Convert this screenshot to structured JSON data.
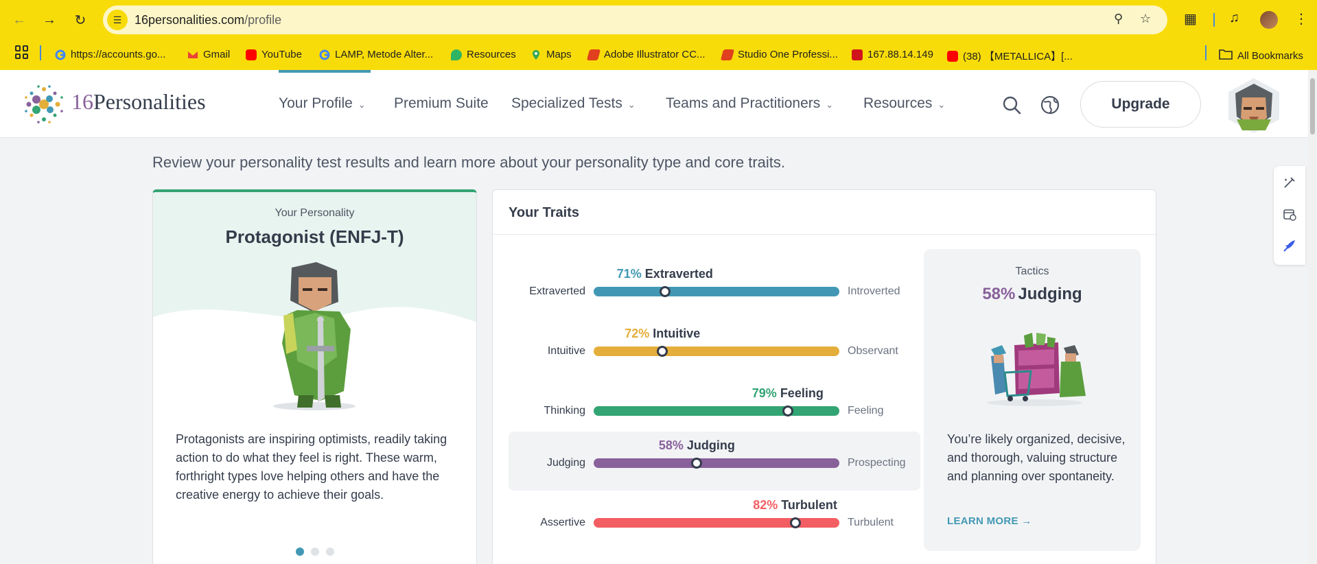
{
  "browser": {
    "url_host": "16personalities.com",
    "url_path": "/profile",
    "bookmarks": [
      {
        "label": "https://accounts.go...",
        "icon": "google-icon"
      },
      {
        "label": "Gmail",
        "icon": "gmail-icon"
      },
      {
        "label": "YouTube",
        "icon": "youtube-icon"
      },
      {
        "label": "LAMP, Metode Alter...",
        "icon": "google-icon"
      },
      {
        "label": "Resources",
        "icon": "pdf-icon"
      },
      {
        "label": "Maps",
        "icon": "maps-icon"
      },
      {
        "label": "Adobe Illustrator CC...",
        "icon": "bookmark-icon"
      },
      {
        "label": "Studio One Professi...",
        "icon": "bookmark-icon"
      },
      {
        "label": "167.88.14.149",
        "icon": "bookmark-icon"
      },
      {
        "label": "(38) 【METALLICA】[...",
        "icon": "youtube-icon"
      }
    ],
    "all_bookmarks": "All Bookmarks"
  },
  "site": {
    "logo_num": "16",
    "logo_word": "Personalities",
    "nav": [
      {
        "label": "Your Profile",
        "dropdown": true
      },
      {
        "label": "Premium Suite",
        "dropdown": false
      },
      {
        "label": "Specialized Tests",
        "dropdown": true
      },
      {
        "label": "Teams and Practitioners",
        "dropdown": true
      },
      {
        "label": "Resources",
        "dropdown": true
      }
    ],
    "upgrade": "Upgrade"
  },
  "intro": "Review your personality test results and learn more about your personality type and core traits.",
  "personality": {
    "label": "Your Personality",
    "title": "Protagonist (ENFJ-T)",
    "description": "Protagonists are inspiring optimists, readily taking action to do what they feel is right. These warm, forthright types love helping others and have the creative energy to achieve their goals.",
    "slides": 3,
    "active_slide": 0
  },
  "traits": {
    "title": "Your Traits",
    "items": [
      {
        "pct": "71%",
        "name": "Extraverted",
        "left": "Extraverted",
        "right": "Introverted",
        "color": "#4298b4",
        "position": 0.29,
        "selected": false
      },
      {
        "pct": "72%",
        "name": "Intuitive",
        "left": "Intuitive",
        "right": "Observant",
        "color": "#e4ae3a",
        "position": 0.28,
        "selected": false
      },
      {
        "pct": "79%",
        "name": "Feeling",
        "left": "Thinking",
        "right": "Feeling",
        "color": "#33a474",
        "position": 0.79,
        "selected": false
      },
      {
        "pct": "58%",
        "name": "Judging",
        "left": "Judging",
        "right": "Prospecting",
        "color": "#88619a",
        "position": 0.42,
        "selected": true
      },
      {
        "pct": "82%",
        "name": "Turbulent",
        "left": "Assertive",
        "right": "Turbulent",
        "color": "#f25e62",
        "position": 0.82,
        "selected": false
      }
    ]
  },
  "tactics": {
    "label": "Tactics",
    "pct": "58%",
    "name": "Judging",
    "description": "You’re likely organized, decisive, and thorough, valuing structure and planning over spontaneity.",
    "learn_more": "LEARN MORE"
  }
}
